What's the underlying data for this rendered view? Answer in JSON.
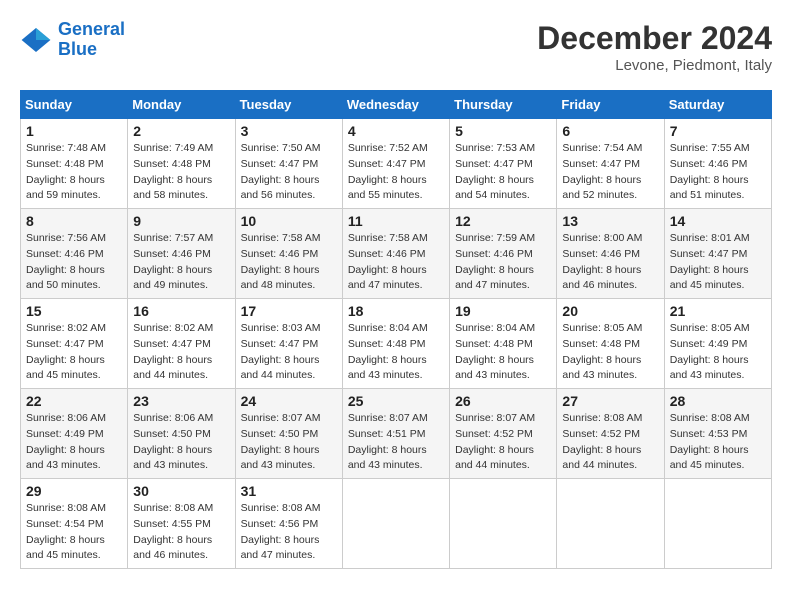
{
  "header": {
    "logo_line1": "General",
    "logo_line2": "Blue",
    "month_title": "December 2024",
    "location": "Levone, Piedmont, Italy"
  },
  "weekdays": [
    "Sunday",
    "Monday",
    "Tuesday",
    "Wednesday",
    "Thursday",
    "Friday",
    "Saturday"
  ],
  "weeks": [
    [
      {
        "day": "1",
        "sunrise": "7:48 AM",
        "sunset": "4:48 PM",
        "daylight": "8 hours and 59 minutes."
      },
      {
        "day": "2",
        "sunrise": "7:49 AM",
        "sunset": "4:48 PM",
        "daylight": "8 hours and 58 minutes."
      },
      {
        "day": "3",
        "sunrise": "7:50 AM",
        "sunset": "4:47 PM",
        "daylight": "8 hours and 56 minutes."
      },
      {
        "day": "4",
        "sunrise": "7:52 AM",
        "sunset": "4:47 PM",
        "daylight": "8 hours and 55 minutes."
      },
      {
        "day": "5",
        "sunrise": "7:53 AM",
        "sunset": "4:47 PM",
        "daylight": "8 hours and 54 minutes."
      },
      {
        "day": "6",
        "sunrise": "7:54 AM",
        "sunset": "4:47 PM",
        "daylight": "8 hours and 52 minutes."
      },
      {
        "day": "7",
        "sunrise": "7:55 AM",
        "sunset": "4:46 PM",
        "daylight": "8 hours and 51 minutes."
      }
    ],
    [
      {
        "day": "8",
        "sunrise": "7:56 AM",
        "sunset": "4:46 PM",
        "daylight": "8 hours and 50 minutes."
      },
      {
        "day": "9",
        "sunrise": "7:57 AM",
        "sunset": "4:46 PM",
        "daylight": "8 hours and 49 minutes."
      },
      {
        "day": "10",
        "sunrise": "7:58 AM",
        "sunset": "4:46 PM",
        "daylight": "8 hours and 48 minutes."
      },
      {
        "day": "11",
        "sunrise": "7:58 AM",
        "sunset": "4:46 PM",
        "daylight": "8 hours and 47 minutes."
      },
      {
        "day": "12",
        "sunrise": "7:59 AM",
        "sunset": "4:46 PM",
        "daylight": "8 hours and 47 minutes."
      },
      {
        "day": "13",
        "sunrise": "8:00 AM",
        "sunset": "4:46 PM",
        "daylight": "8 hours and 46 minutes."
      },
      {
        "day": "14",
        "sunrise": "8:01 AM",
        "sunset": "4:47 PM",
        "daylight": "8 hours and 45 minutes."
      }
    ],
    [
      {
        "day": "15",
        "sunrise": "8:02 AM",
        "sunset": "4:47 PM",
        "daylight": "8 hours and 45 minutes."
      },
      {
        "day": "16",
        "sunrise": "8:02 AM",
        "sunset": "4:47 PM",
        "daylight": "8 hours and 44 minutes."
      },
      {
        "day": "17",
        "sunrise": "8:03 AM",
        "sunset": "4:47 PM",
        "daylight": "8 hours and 44 minutes."
      },
      {
        "day": "18",
        "sunrise": "8:04 AM",
        "sunset": "4:48 PM",
        "daylight": "8 hours and 43 minutes."
      },
      {
        "day": "19",
        "sunrise": "8:04 AM",
        "sunset": "4:48 PM",
        "daylight": "8 hours and 43 minutes."
      },
      {
        "day": "20",
        "sunrise": "8:05 AM",
        "sunset": "4:48 PM",
        "daylight": "8 hours and 43 minutes."
      },
      {
        "day": "21",
        "sunrise": "8:05 AM",
        "sunset": "4:49 PM",
        "daylight": "8 hours and 43 minutes."
      }
    ],
    [
      {
        "day": "22",
        "sunrise": "8:06 AM",
        "sunset": "4:49 PM",
        "daylight": "8 hours and 43 minutes."
      },
      {
        "day": "23",
        "sunrise": "8:06 AM",
        "sunset": "4:50 PM",
        "daylight": "8 hours and 43 minutes."
      },
      {
        "day": "24",
        "sunrise": "8:07 AM",
        "sunset": "4:50 PM",
        "daylight": "8 hours and 43 minutes."
      },
      {
        "day": "25",
        "sunrise": "8:07 AM",
        "sunset": "4:51 PM",
        "daylight": "8 hours and 43 minutes."
      },
      {
        "day": "26",
        "sunrise": "8:07 AM",
        "sunset": "4:52 PM",
        "daylight": "8 hours and 44 minutes."
      },
      {
        "day": "27",
        "sunrise": "8:08 AM",
        "sunset": "4:52 PM",
        "daylight": "8 hours and 44 minutes."
      },
      {
        "day": "28",
        "sunrise": "8:08 AM",
        "sunset": "4:53 PM",
        "daylight": "8 hours and 45 minutes."
      }
    ],
    [
      {
        "day": "29",
        "sunrise": "8:08 AM",
        "sunset": "4:54 PM",
        "daylight": "8 hours and 45 minutes."
      },
      {
        "day": "30",
        "sunrise": "8:08 AM",
        "sunset": "4:55 PM",
        "daylight": "8 hours and 46 minutes."
      },
      {
        "day": "31",
        "sunrise": "8:08 AM",
        "sunset": "4:56 PM",
        "daylight": "8 hours and 47 minutes."
      },
      null,
      null,
      null,
      null
    ]
  ]
}
